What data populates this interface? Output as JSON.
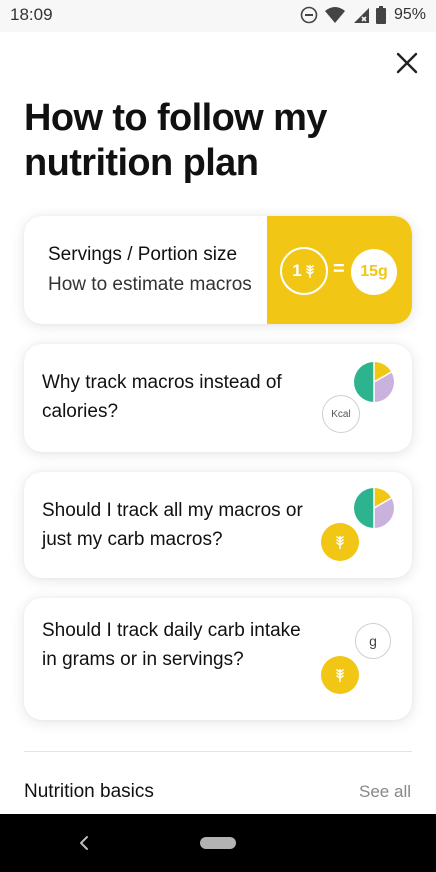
{
  "status_bar": {
    "time": "18:09",
    "battery": "95%",
    "icons": [
      "do-not-disturb-icon",
      "wifi-icon",
      "cell-signal-icon",
      "battery-icon"
    ]
  },
  "header": {
    "close_icon": "close-icon",
    "title": "How to follow my nutrition plan"
  },
  "cards": [
    {
      "title": "Servings / Portion size",
      "subtitle": "How to estimate macros",
      "serving_count": "1",
      "equals": "=",
      "grams": "15g"
    },
    {
      "title": "Why track macros instead of calories?",
      "badge": "Kcal"
    },
    {
      "title": "Should I track all my macros or just my carb macros?"
    },
    {
      "title": "Should I track daily carb intake in grams or in servings?",
      "badge": "g"
    }
  ],
  "section": {
    "title": "Nutrition basics",
    "see_all": "See all"
  },
  "colors": {
    "accent_yellow": "#f2c615",
    "macro_green": "#2db48f",
    "macro_purple": "#c9b3de",
    "macro_yellow": "#f2c615"
  }
}
